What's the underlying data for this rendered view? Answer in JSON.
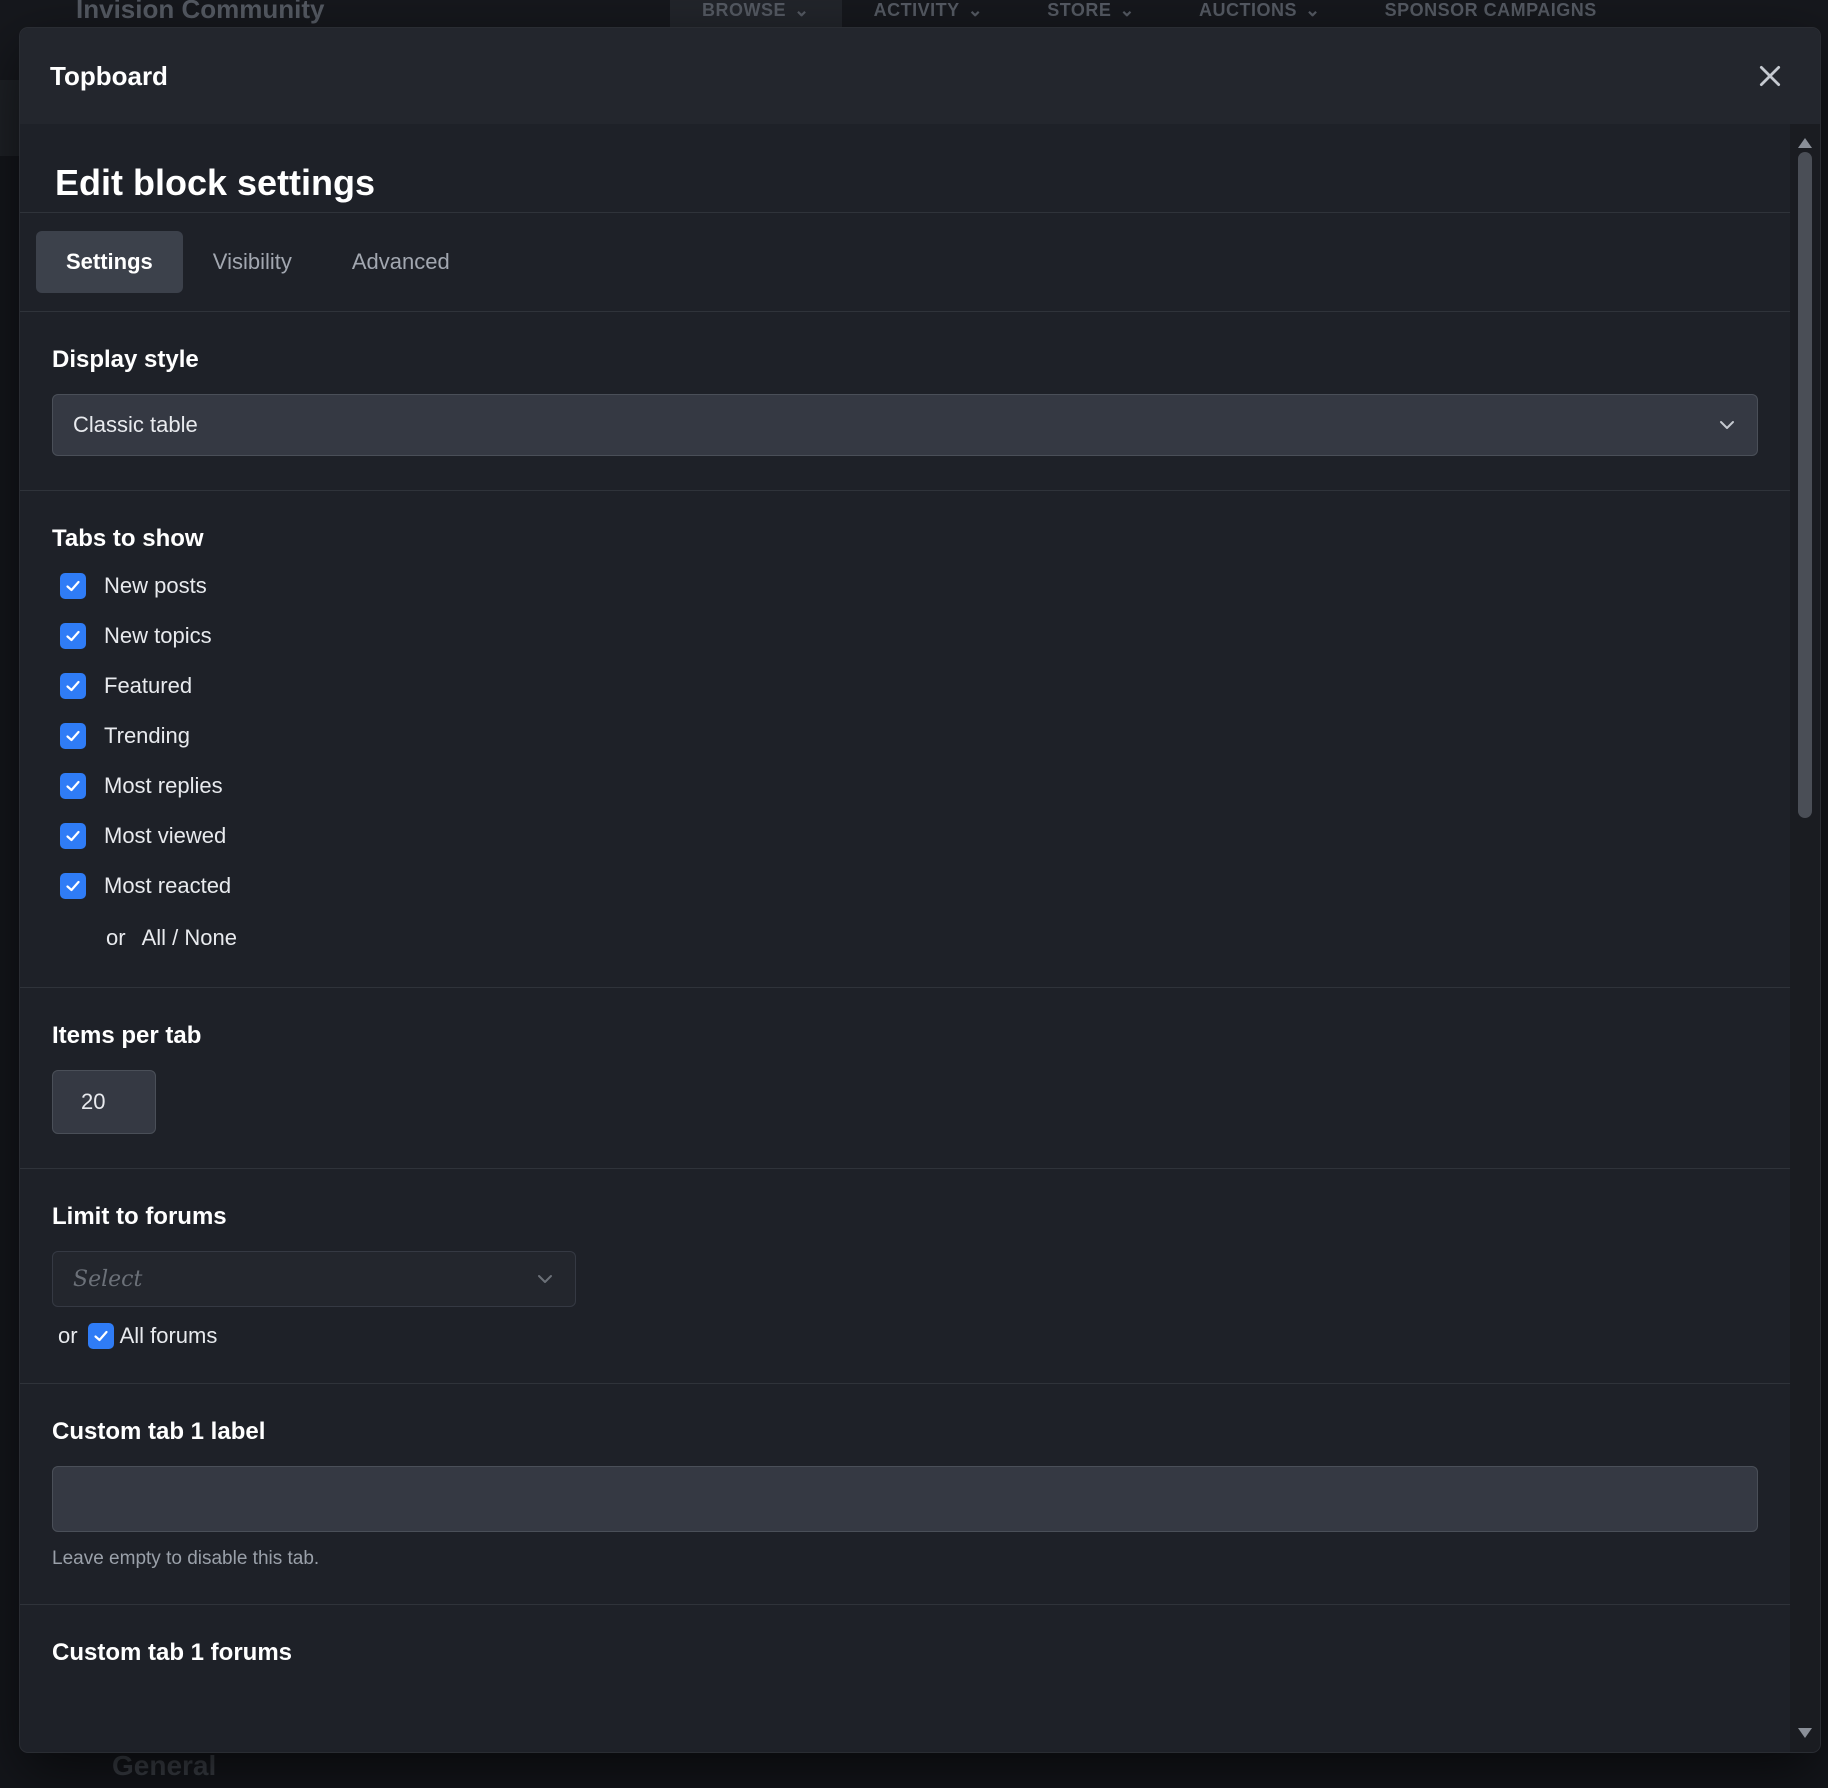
{
  "background": {
    "brand": "Invision Community",
    "menu": [
      "BROWSE",
      "ACTIVITY",
      "STORE",
      "AUCTIONS",
      "SPONSOR CAMPAIGNS"
    ],
    "bottom_text": "General"
  },
  "modal": {
    "title": "Topboard",
    "heading": "Edit block settings",
    "tabs": [
      "Settings",
      "Visibility",
      "Advanced"
    ],
    "active_tab": "Settings"
  },
  "display_style": {
    "label": "Display style",
    "value": "Classic table"
  },
  "tabs_to_show": {
    "label": "Tabs to show",
    "items": [
      {
        "label": "New posts",
        "checked": true
      },
      {
        "label": "New topics",
        "checked": true
      },
      {
        "label": "Featured",
        "checked": true
      },
      {
        "label": "Trending",
        "checked": true
      },
      {
        "label": "Most replies",
        "checked": true
      },
      {
        "label": "Most viewed",
        "checked": true
      },
      {
        "label": "Most reacted",
        "checked": true
      }
    ],
    "or_text": "or",
    "all_none": "All / None"
  },
  "items_per_tab": {
    "label": "Items per tab",
    "value": "20"
  },
  "limit_forums": {
    "label": "Limit to forums",
    "placeholder": "Select",
    "or_text": "or",
    "all_forums_label": "All forums",
    "all_forums_checked": true
  },
  "custom_tab_1_label": {
    "label": "Custom tab 1 label",
    "value": "",
    "hint": "Leave empty to disable this tab."
  },
  "custom_tab_1_forums": {
    "label": "Custom tab 1 forums"
  },
  "colors": {
    "accent": "#2f7cf6",
    "modal_bg": "#1e2128",
    "input_bg": "#353943"
  }
}
